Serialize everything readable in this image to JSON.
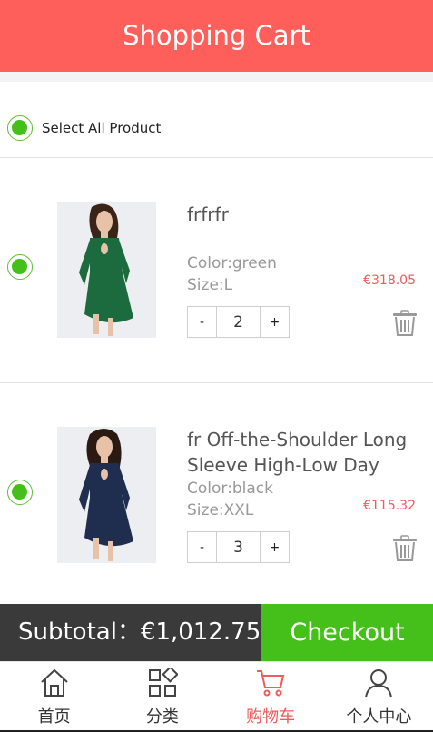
{
  "header": {
    "title": "Shopping Cart"
  },
  "select_all": {
    "label": "Select All Product",
    "checked": true
  },
  "items": [
    {
      "name": "frfrfr",
      "color": "Color:green",
      "size": "Size:L",
      "price": "€318.05",
      "quantity": "2",
      "minus": "-",
      "plus": "+",
      "selected": true,
      "dress_color": "#1c6b3f"
    },
    {
      "name": "fr Off-the-Shoulder Long Sleeve High-Low Day",
      "color": "Color:black",
      "size": "Size:XXL",
      "price": "€115.32",
      "quantity": "3",
      "minus": "-",
      "plus": "+",
      "selected": true,
      "dress_color": "#1f2e4e"
    }
  ],
  "footer": {
    "subtotal": "Subtotal：€1,012.75",
    "checkout": "Checkout"
  },
  "tabbar": [
    {
      "label": "首页",
      "icon": "home-icon",
      "active": false
    },
    {
      "label": "分类",
      "icon": "category-icon",
      "active": false
    },
    {
      "label": "购物车",
      "icon": "cart-icon",
      "active": true
    },
    {
      "label": "个人中心",
      "icon": "user-icon",
      "active": false
    }
  ],
  "colors": {
    "header": "#fe5f5a",
    "accent_green": "#45c01a",
    "price_red": "#f15b5b",
    "subtotal_bg": "#3a3a3a"
  }
}
